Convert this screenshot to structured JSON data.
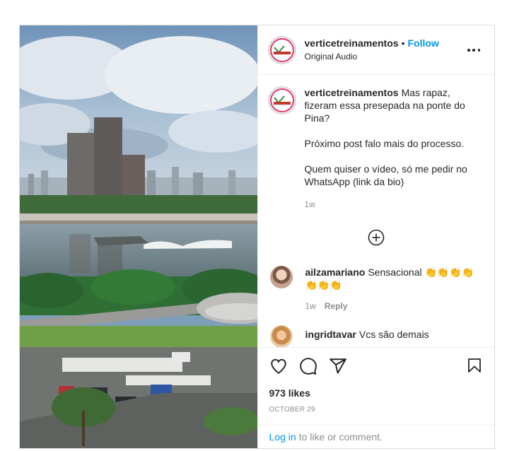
{
  "post": {
    "username": "verticetreinamentos",
    "separator": "•",
    "follow_label": "Follow",
    "audio_label": "Original Audio",
    "more_icon": "more-options-icon",
    "avatar_icon": "vertice-logo"
  },
  "caption": {
    "username": "verticetreinamentos",
    "line1": "Mas rapaz, fizeram essa presepada na ponte do Pina?",
    "line2": "Próximo post falo mais do processo.",
    "line3": "Quem quiser o vídeo, só me pedir no WhatsApp (link da bio)",
    "time": "1w"
  },
  "load_more_icon": "plus-circle-icon",
  "comments": [
    {
      "username": "ailzamariano",
      "text": "Sensacional 👏👏👏👏👏👏👏",
      "time": "1w",
      "reply_label": "Reply"
    },
    {
      "username": "ingridtavar",
      "text": "Vcs são demais"
    }
  ],
  "actions": {
    "like_icon": "heart-icon",
    "comment_icon": "comment-icon",
    "share_icon": "send-icon",
    "save_icon": "bookmark-icon",
    "likes": "973 likes",
    "date": "OCTOBER 29"
  },
  "footer": {
    "login_label": "Log in",
    "login_suffix": "to like or comment."
  },
  "colors": {
    "accent": "#0095f6",
    "muted": "#8e8e8e",
    "border": "#dbdbdb"
  }
}
